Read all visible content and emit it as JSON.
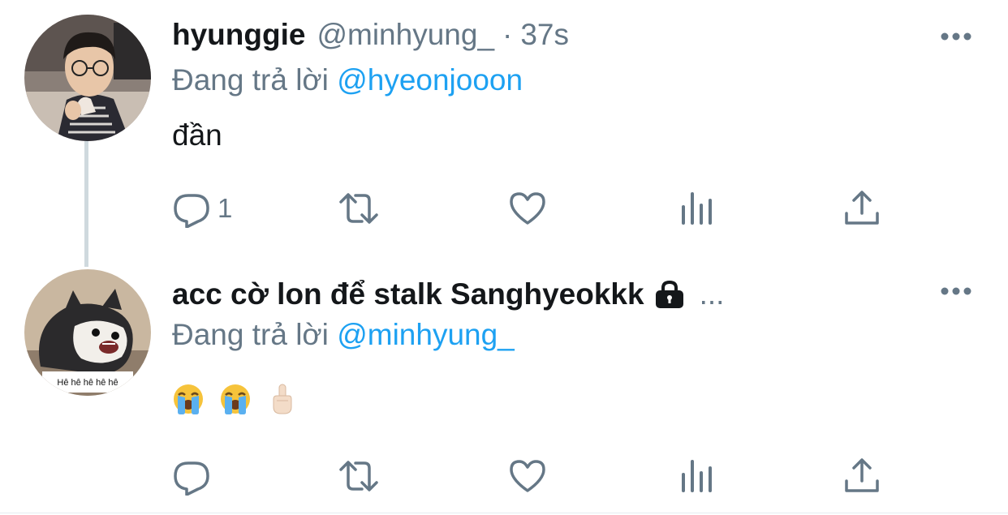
{
  "tweets": [
    {
      "display_name": "hyunggie",
      "handle": "@minhyung_",
      "separator": "·",
      "time": "37s",
      "reply_prefix": "Đang trả lời",
      "reply_to": "@hyeonjooon",
      "text": "đần",
      "reply_count": "1",
      "avatar_icon": "person-photo-icon"
    },
    {
      "display_name": "acc cờ lon để stalk Sanghyeokkk",
      "protected_icon": "lock-icon",
      "truncation": "...",
      "reply_prefix": "Đang trả lời",
      "reply_to": "@minhyung_",
      "emojis": [
        "loudly-crying-face",
        "loudly-crying-face",
        "middle-finger"
      ],
      "avatar_caption": "Hê hê hê hê hê",
      "avatar_icon": "husky-dog-icon"
    }
  ],
  "colors": {
    "text": "#14171a",
    "secondary": "#657786",
    "link": "#1da1f2",
    "thread_line": "#cfd9de"
  }
}
